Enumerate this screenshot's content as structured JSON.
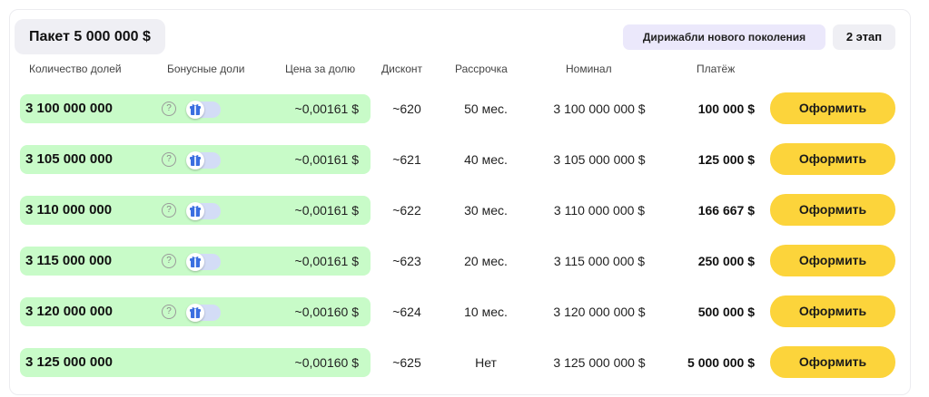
{
  "package": {
    "title": "Пакет 5 000 000 $"
  },
  "tags": {
    "project": "Дирижабли нового поколения",
    "stage": "2 этап"
  },
  "columns": {
    "shares": "Количество долей",
    "bonus": "Бонусные доли",
    "price": "Цена за долю",
    "discount": "Дисконт",
    "installment": "Рассрочка",
    "nominal": "Номинал",
    "payment": "Платёж"
  },
  "help_glyph": "?",
  "colors": {
    "row_bg": "#c8fbc8",
    "button": "#fcd43b",
    "toggle_track": "#d3dcf6",
    "gift_icon": "#3b6fe0"
  },
  "rows": [
    {
      "shares": "3 100 000 000",
      "has_bonus": true,
      "bonus_enabled": false,
      "price": "~0,00161 $",
      "discount": "~620",
      "installment": "50 мес.",
      "nominal": "3 100 000 000 $",
      "payment": "100 000 $",
      "button": "Оформить"
    },
    {
      "shares": "3 105 000 000",
      "has_bonus": true,
      "bonus_enabled": false,
      "price": "~0,00161 $",
      "discount": "~621",
      "installment": "40 мес.",
      "nominal": "3 105 000 000 $",
      "payment": "125 000 $",
      "button": "Оформить"
    },
    {
      "shares": "3 110 000 000",
      "has_bonus": true,
      "bonus_enabled": false,
      "price": "~0,00161 $",
      "discount": "~622",
      "installment": "30 мес.",
      "nominal": "3 110 000 000 $",
      "payment": "166 667 $",
      "button": "Оформить"
    },
    {
      "shares": "3 115 000 000",
      "has_bonus": true,
      "bonus_enabled": false,
      "price": "~0,00161 $",
      "discount": "~623",
      "installment": "20 мес.",
      "nominal": "3 115 000 000 $",
      "payment": "250 000 $",
      "button": "Оформить"
    },
    {
      "shares": "3 120 000 000",
      "has_bonus": true,
      "bonus_enabled": false,
      "price": "~0,00160 $",
      "discount": "~624",
      "installment": "10 мес.",
      "nominal": "3 120 000 000 $",
      "payment": "500 000 $",
      "button": "Оформить"
    },
    {
      "shares": "3 125 000 000",
      "has_bonus": false,
      "bonus_enabled": false,
      "price": "~0,00160 $",
      "discount": "~625",
      "installment": "Нет",
      "nominal": "3 125 000 000 $",
      "payment": "5 000 000 $",
      "button": "Оформить"
    }
  ]
}
